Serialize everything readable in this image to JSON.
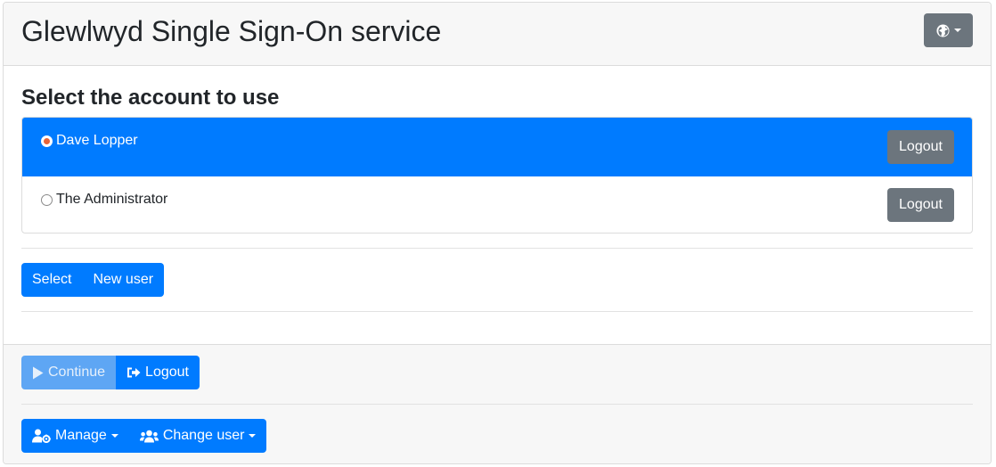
{
  "header": {
    "title": "Glewlwyd Single Sign-On service"
  },
  "main": {
    "section_title": "Select the account to use",
    "accounts": [
      {
        "name": "Dave Lopper",
        "selected": true,
        "logout_label": "Logout"
      },
      {
        "name": "The Administrator",
        "selected": false,
        "logout_label": "Logout"
      }
    ],
    "select_label": "Select",
    "new_user_label": "New user"
  },
  "footer": {
    "continue_label": "Continue",
    "logout_label": "Logout",
    "manage_label": "Manage",
    "change_user_label": "Change user"
  },
  "colors": {
    "primary": "#007bff",
    "secondary": "#6c757d",
    "header_bg": "#f7f7f7",
    "radio_dot": "#e8643a"
  },
  "icons": {
    "language": "globe-icon",
    "continue": "play-icon",
    "logout": "sign-out-icon",
    "manage": "user-cog-icon",
    "change_user": "users-icon"
  }
}
